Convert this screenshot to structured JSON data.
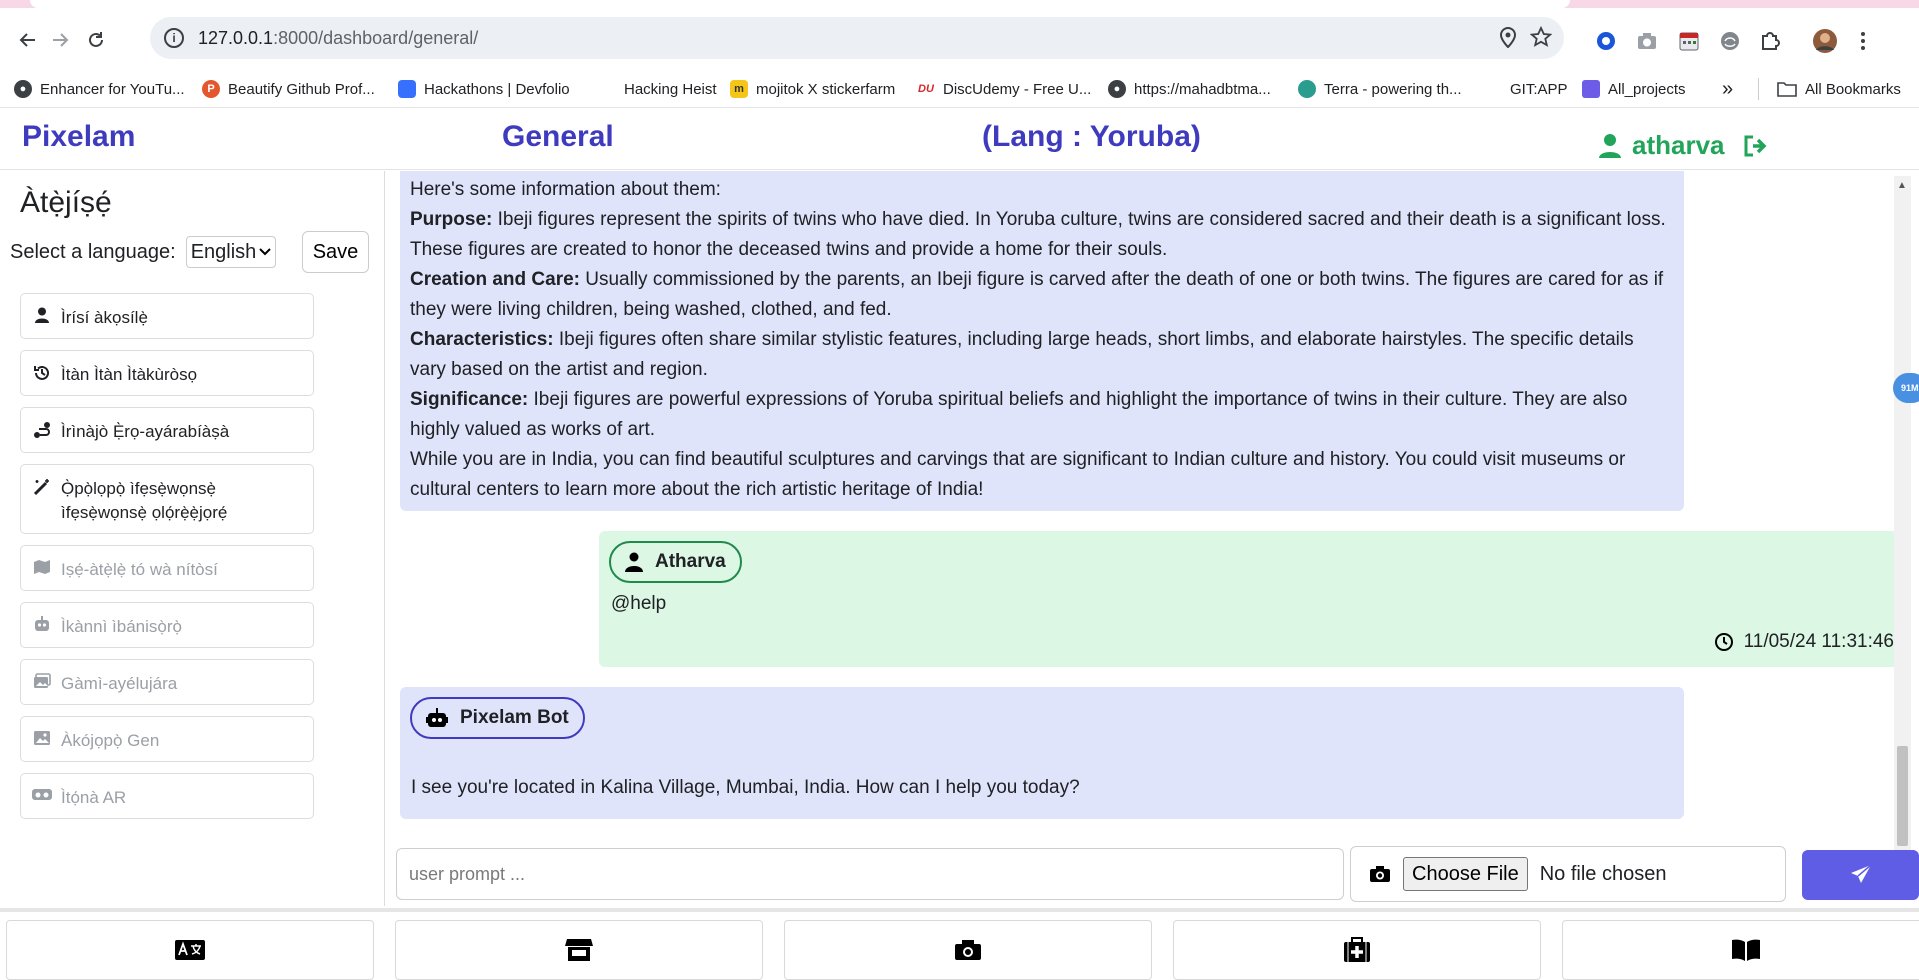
{
  "browser": {
    "url_host": "127.0.0.1",
    "url_path": ":8000/dashboard/general/",
    "bookmarks": [
      {
        "label": "Enhancer for YouTu...",
        "color": "#3c4043"
      },
      {
        "label": "Beautify Github Prof...",
        "color": "#e4572e"
      },
      {
        "label": "Hackathons | Devfolio",
        "color": "#3770ff"
      },
      {
        "label": "Hacking Heist",
        "color": "#ffffff"
      },
      {
        "label": "mojitok X stickerfarm",
        "color": "#f5c518"
      },
      {
        "label": "DiscUdemy - Free U...",
        "color": "#d62828"
      },
      {
        "label": "https://mahadbtma...",
        "color": "#3c4043"
      },
      {
        "label": "Terra - powering th...",
        "color": "#2a9d8f"
      },
      {
        "label": "GIT:APP",
        "color": "#ffffff"
      },
      {
        "label": "All_projects",
        "color": "#6c5ce7"
      }
    ],
    "overflow_label": "»",
    "all_bookmarks_label": "All Bookmarks"
  },
  "header": {
    "brand": "Pixelam",
    "section": "General",
    "language": "(Lang : Yoruba)",
    "username": "atharva"
  },
  "sidebar": {
    "title": "Àtẹ̀jíṣẹ́",
    "select_label": "Select a language:",
    "selected_language": "English",
    "save_label": "Save",
    "items": [
      {
        "label": "Ìrísí àkọsílẹ̀",
        "icon": "user-icon",
        "enabled": true
      },
      {
        "label": "Ìtàn Ìtàn Ìtàkùròsọ",
        "icon": "history-icon",
        "enabled": true
      },
      {
        "label": "Ìrìnàjò Ẹ̀rọ-ayárabíàṣà",
        "icon": "route-icon",
        "enabled": true
      },
      {
        "label": "Ọ̀pọ̀lọpọ̀ ìfẹsẹ̀wọnsẹ̀ ìfẹsẹ̀wọnsẹ̀ ọlọ́rẹ̀ẹ̀jọrẹ́",
        "icon": "magic-wand-icon",
        "enabled": true
      },
      {
        "label": "Iṣẹ́-àtẹ̀lẹ̀ tó wà nítòsí",
        "icon": "map-icon",
        "enabled": false
      },
      {
        "label": "Ìkànnì ìbánisọ̀rọ̀",
        "icon": "robot-icon",
        "enabled": false
      },
      {
        "label": "Gàmì-ayélujára",
        "icon": "images-icon",
        "enabled": false
      },
      {
        "label": "Àkójọpọ̀ Gen",
        "icon": "image-icon",
        "enabled": false
      },
      {
        "label": "Ìtọ́nà AR",
        "icon": "vr-headset-icon",
        "enabled": false
      }
    ]
  },
  "chat": {
    "top_message": {
      "intro": "Here's some information about them:",
      "paragraphs": [
        {
          "label": "Purpose:",
          "text": " Ibeji figures represent the spirits of twins who have died. In Yoruba culture, twins are considered sacred and their death is a significant loss. These figures are created to honor the deceased twins and provide a home for their souls."
        },
        {
          "label": "Creation and Care:",
          "text": " Usually commissioned by the parents, an Ibeji figure is carved after the death of one or both twins. The figures are cared for as if they were living children, being washed, clothed, and fed."
        },
        {
          "label": "Characteristics:",
          "text": " Ibeji figures often share similar stylistic features, including large heads, short limbs, and elaborate hairstyles. The specific details vary based on the artist and region."
        },
        {
          "label": "Significance:",
          "text": " Ibeji figures are powerful expressions of Yoruba spiritual beliefs and highlight the importance of twins in their culture. They are also highly valued as works of art."
        }
      ],
      "closing": "While you are in India, you can find beautiful sculptures and carvings that are significant to Indian culture and history. You could visit museums or cultural centers to learn more about the rich artistic heritage of India!"
    },
    "user_message": {
      "sender": "Atharva",
      "text": "@help",
      "timestamp": "11/05/24 11:31:46"
    },
    "bot_message": {
      "sender": "Pixelam Bot",
      "text": "I see you're located in Kalina Village, Mumbai, India. How can I help you today?"
    },
    "floating_badge": "91M"
  },
  "composer": {
    "placeholder": "user prompt ...",
    "choose_file_label": "Choose File",
    "no_file_label": "No file chosen"
  },
  "bottom_nav": [
    {
      "icon": "translate-icon"
    },
    {
      "icon": "store-icon"
    },
    {
      "icon": "camera-icon"
    },
    {
      "icon": "medical-kit-icon"
    },
    {
      "icon": "book-icon"
    }
  ],
  "colors": {
    "brand": "#3f3bbf",
    "user_green": "#22a55a",
    "bot_bubble": "#dfe4fb",
    "user_bubble": "#dcf7e4",
    "send_button": "#5f5ce6"
  }
}
